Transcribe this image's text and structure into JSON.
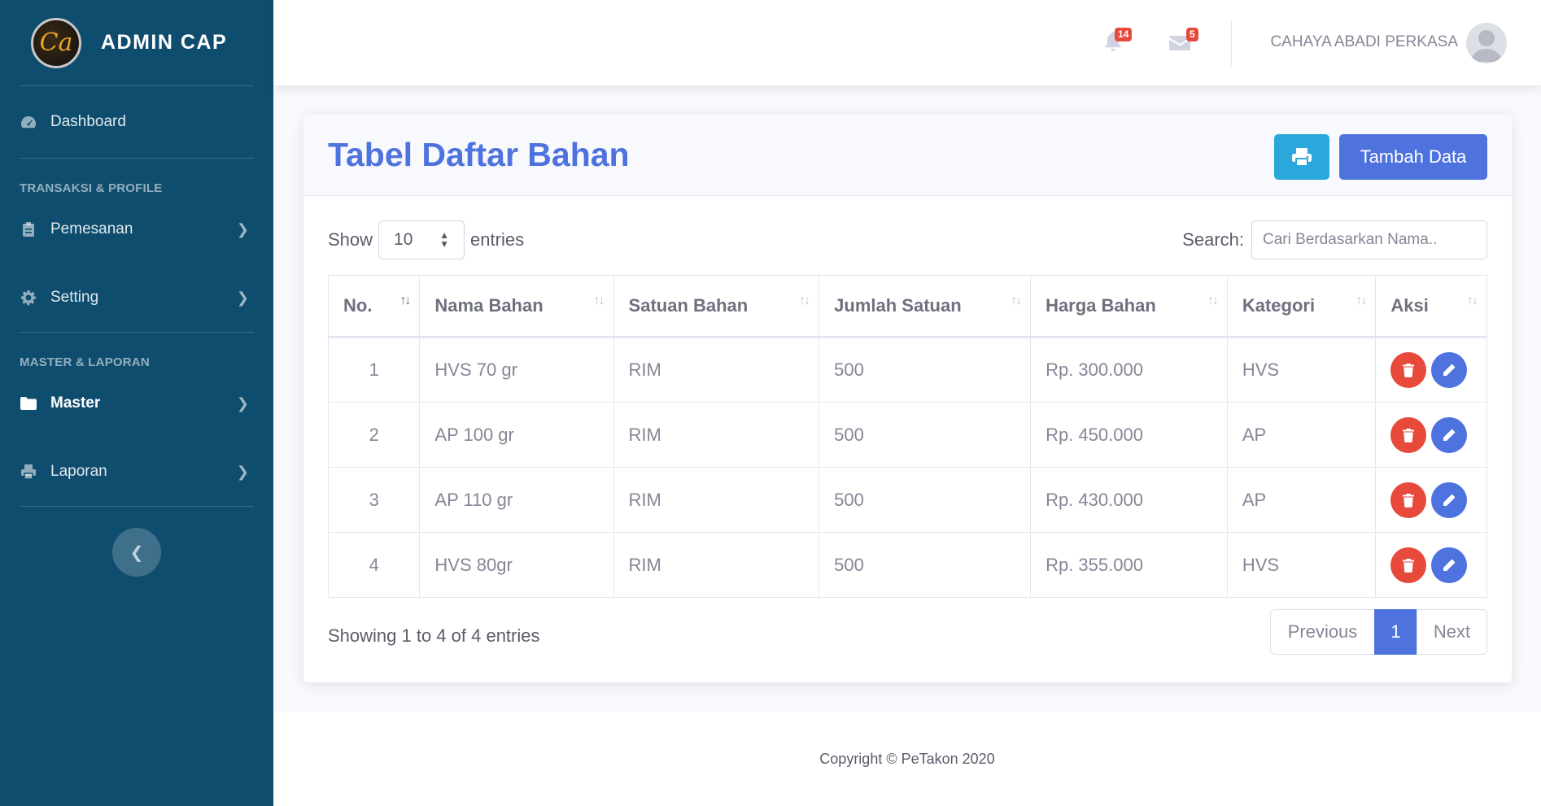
{
  "sidebar": {
    "brand_logo_text": "Ca",
    "brand_name": "ADMIN CAP",
    "dashboard": "Dashboard",
    "heading_1": "TRANSAKSI & PROFILE",
    "pemesanan": "Pemesanan",
    "setting": "Setting",
    "heading_2": "MASTER & LAPORAN",
    "master": "Master",
    "laporan": "Laporan"
  },
  "topbar": {
    "alerts_count": "14",
    "messages_count": "5",
    "user_name": "CAHAYA ABADI PERKASA"
  },
  "card": {
    "title": "Tabel Daftar Bahan",
    "add_button": "Tambah Data"
  },
  "datatable": {
    "show_label": "Show",
    "entries_label": "entries",
    "page_length": "10",
    "search_label": "Search:",
    "search_placeholder": "Cari Berdasarkan Nama..",
    "columns": [
      "No.",
      "Nama Bahan",
      "Satuan Bahan",
      "Jumlah Satuan",
      "Harga Bahan",
      "Kategori",
      "Aksi"
    ],
    "rows": [
      {
        "no": "1",
        "nama": "HVS 70 gr",
        "satuan": "RIM",
        "jumlah": "500",
        "harga": "Rp. 300.000",
        "kategori": "HVS"
      },
      {
        "no": "2",
        "nama": "AP 100 gr",
        "satuan": "RIM",
        "jumlah": "500",
        "harga": "Rp. 450.000",
        "kategori": "AP"
      },
      {
        "no": "3",
        "nama": "AP 110 gr",
        "satuan": "RIM",
        "jumlah": "500",
        "harga": "Rp. 430.000",
        "kategori": "AP"
      },
      {
        "no": "4",
        "nama": "HVS 80gr",
        "satuan": "RIM",
        "jumlah": "500",
        "harga": "Rp. 355.000",
        "kategori": "HVS"
      }
    ],
    "info": "Showing 1 to 4 of 4 entries",
    "previous": "Previous",
    "current_page": "1",
    "next": "Next"
  },
  "footer": {
    "copyright": "Copyright © PeTakon 2020"
  },
  "colors": {
    "sidebar_bg": "#0f4d6e",
    "primary": "#4e73df",
    "info": "#2aa8dc",
    "danger": "#e74a3b"
  }
}
